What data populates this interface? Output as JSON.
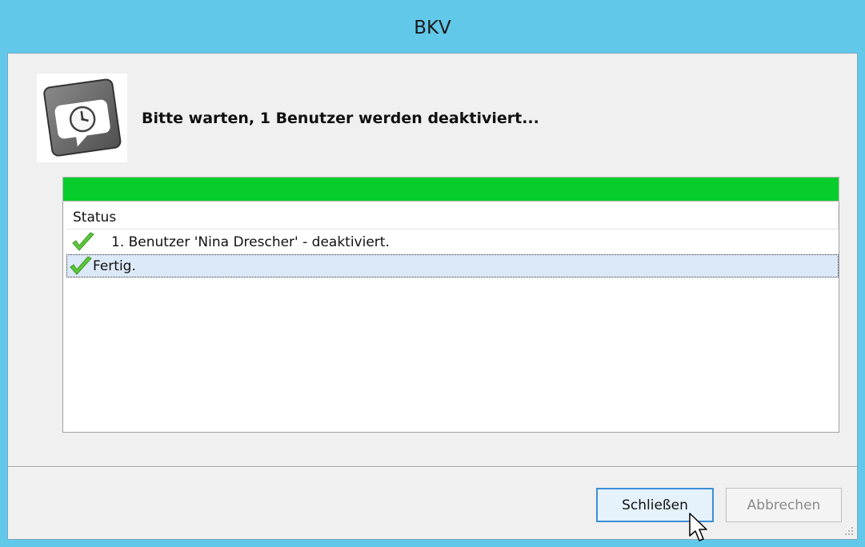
{
  "window": {
    "title": "BKV"
  },
  "header": {
    "message": "Bitte warten, 1 Benutzer werden deaktiviert...",
    "icon": "clock-speech-bubble-icon"
  },
  "progress": {
    "value": 1.0,
    "color": "#06cd2b"
  },
  "list": {
    "column_header": "Status",
    "rows": [
      {
        "text": "1. Benutzer 'Nina Drescher' - deaktiviert.",
        "icon": "green-checkmark-icon",
        "selected": false
      },
      {
        "text": "Fertig.",
        "icon": "green-checkmark-icon",
        "selected": true
      }
    ]
  },
  "buttons": {
    "close_label": "Schließen",
    "cancel_label": "Abbrechen"
  },
  "colors": {
    "titlebar": "#62c8ea",
    "client": "#f0f0f0",
    "selection": "#dce9f8",
    "accent_border": "#3c8fd6"
  }
}
